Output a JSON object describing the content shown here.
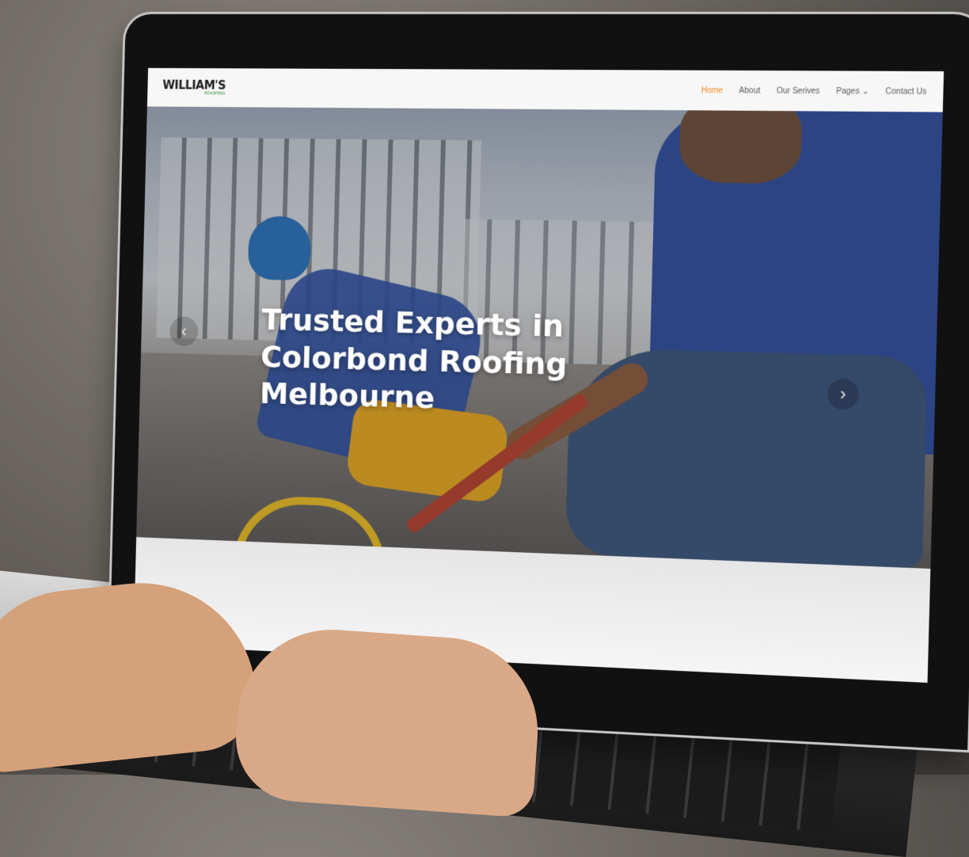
{
  "site": {
    "logo_text": "WILLIAM'S",
    "logo_subtext": "ROOFING"
  },
  "nav": {
    "items": [
      {
        "label": "Home",
        "active": true
      },
      {
        "label": "About",
        "active": false
      },
      {
        "label": "Our Serives",
        "active": false
      },
      {
        "label": "Pages",
        "active": false,
        "has_dropdown": true
      },
      {
        "label": "Contact Us",
        "active": false
      }
    ],
    "active_color": "#ec8a1c"
  },
  "hero": {
    "title": "Trusted Experts in Colorbond Roofing Melbourne",
    "prev_icon": "chevron-left-icon",
    "next_icon": "chevron-right-icon"
  }
}
